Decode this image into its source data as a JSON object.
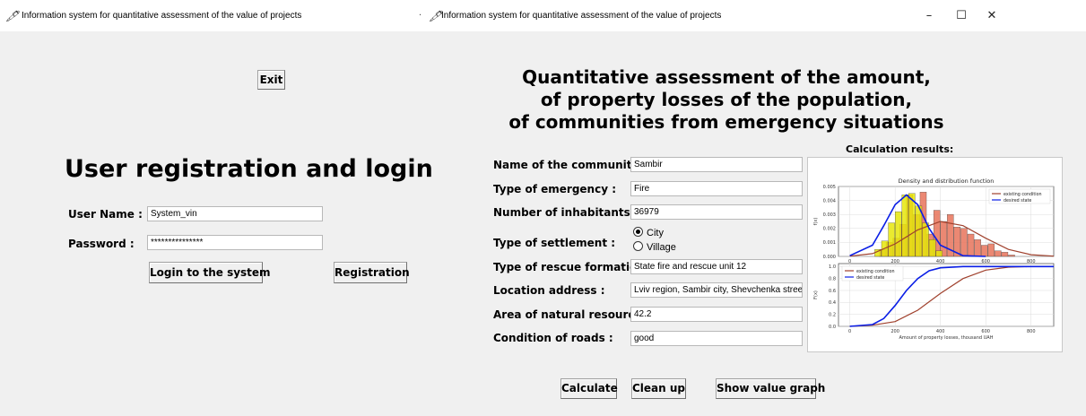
{
  "windows": {
    "left_title": "Information system for quantitative assessment of the value of projects",
    "right_title": "Information system for quantitative assessment of the value of projects",
    "controls": {
      "minimize": "–",
      "maximize": "☐",
      "close": "✕"
    }
  },
  "login": {
    "exit_label": "Exit",
    "heading": "User registration and login",
    "username_label": "User Name :",
    "username_value": "System_vin",
    "password_label": "Password :",
    "password_value": "***************",
    "login_button": "Login to the system",
    "register_button": "Registration"
  },
  "assessment": {
    "heading_line1": "Quantitative assessment of the amount,",
    "heading_line2": "of property losses of the population,",
    "heading_line3": "of communities from emergency situations",
    "results_label": "Calculation results:",
    "fields": [
      {
        "label": "Name of the community :",
        "value": "Sambir"
      },
      {
        "label": "Type of emergency :",
        "value": "Fire"
      },
      {
        "label": "Number of inhabitants :",
        "value": "36979"
      },
      {
        "label": "Type of rescue formation :",
        "value": "State fire and rescue unit 12"
      },
      {
        "label": "Location address :",
        "value": "Lviv region, Sambir city, Shevchenka street, bu"
      },
      {
        "label": "Area of natural resources :",
        "value": "42.2"
      },
      {
        "label": "Condition of roads :",
        "value": "good"
      }
    ],
    "settlement_label": "Type of settlement :",
    "settlement_options": [
      "City",
      "Village"
    ],
    "settlement_selected": "City",
    "buttons": {
      "calculate": "Calculate",
      "clean": "Clean up",
      "show_graph": "Show value graph"
    }
  },
  "chart_data": [
    {
      "type": "bar",
      "title": "Density and distribution function",
      "xlabel": "",
      "ylabel": "f(x)",
      "xlim": [
        -50,
        900
      ],
      "ylim": [
        0,
        0.005
      ],
      "xticks": [
        0,
        200,
        400,
        600,
        800
      ],
      "yticks": [
        0.0,
        0.001,
        0.002,
        0.003,
        0.004,
        0.005
      ],
      "ytick_labels": [
        "0.000",
        "0.001",
        "0.002",
        "0.003",
        "0.004",
        "0.005"
      ],
      "legend": [
        "existing condition",
        "desired state"
      ],
      "legend_position": "top-right",
      "series": [
        {
          "name": "existing condition",
          "kind": "line",
          "color": "#a0412d",
          "x": [
            0,
            100,
            200,
            300,
            400,
            500,
            600,
            700,
            800,
            900
          ],
          "values": [
            2e-05,
            0.0002,
            0.0009,
            0.0019,
            0.0025,
            0.0022,
            0.0013,
            0.0005,
            0.00012,
            2e-05
          ]
        },
        {
          "name": "desired state",
          "kind": "line",
          "color": "#0a1ee6",
          "x": [
            0,
            100,
            150,
            200,
            250,
            300,
            350,
            400,
            500,
            600
          ],
          "values": [
            5e-05,
            0.0008,
            0.0022,
            0.0037,
            0.0044,
            0.0037,
            0.002,
            0.0008,
            5e-05,
            0.0
          ]
        },
        {
          "name": "existing histogram",
          "kind": "bars",
          "color": "#e8735a",
          "x": [
            130,
            160,
            190,
            220,
            250,
            280,
            310,
            340,
            370,
            400,
            430,
            460,
            490,
            520,
            550,
            580,
            610,
            640,
            670,
            700
          ],
          "values": [
            0.0005,
            0.001,
            0.0013,
            0.0023,
            0.0044,
            0.003,
            0.0046,
            0.0016,
            0.0033,
            0.0025,
            0.003,
            0.0021,
            0.002,
            0.0016,
            0.0012,
            0.0008,
            0.0009,
            0.0004,
            0.0003,
            0.0001
          ]
        },
        {
          "name": "desired histogram",
          "kind": "bars",
          "color": "#e6e60a",
          "x": [
            110,
            140,
            170,
            200,
            230,
            260,
            290,
            320,
            350,
            380
          ],
          "values": [
            0.0005,
            0.0011,
            0.0024,
            0.0032,
            0.0044,
            0.0045,
            0.0036,
            0.0024,
            0.0012,
            0.0004
          ]
        }
      ]
    },
    {
      "type": "line",
      "title": "",
      "xlabel": "Amount of property losses, thousand UAH",
      "ylabel": "F(x)",
      "xlim": [
        -50,
        900
      ],
      "ylim": [
        0,
        1.05
      ],
      "xticks": [
        0,
        200,
        400,
        600,
        800
      ],
      "yticks": [
        0.0,
        0.2,
        0.4,
        0.6,
        0.8,
        1.0
      ],
      "ytick_labels": [
        "0.0",
        "0.2",
        "0.4",
        "0.6",
        "0.8",
        "1.0"
      ],
      "legend": [
        "existing condition",
        "desired state"
      ],
      "legend_position": "top-left",
      "series": [
        {
          "name": "existing condition",
          "color": "#a0412d",
          "x": [
            0,
            100,
            200,
            300,
            400,
            500,
            600,
            700,
            800,
            900
          ],
          "values": [
            0.0,
            0.02,
            0.08,
            0.27,
            0.55,
            0.8,
            0.94,
            0.99,
            1.0,
            1.0
          ]
        },
        {
          "name": "desired state",
          "color": "#0a1ee6",
          "x": [
            0,
            100,
            150,
            200,
            250,
            300,
            350,
            400,
            500,
            600,
            900
          ],
          "values": [
            0.0,
            0.03,
            0.13,
            0.35,
            0.6,
            0.8,
            0.93,
            0.98,
            1.0,
            1.0,
            1.0
          ]
        }
      ]
    }
  ]
}
